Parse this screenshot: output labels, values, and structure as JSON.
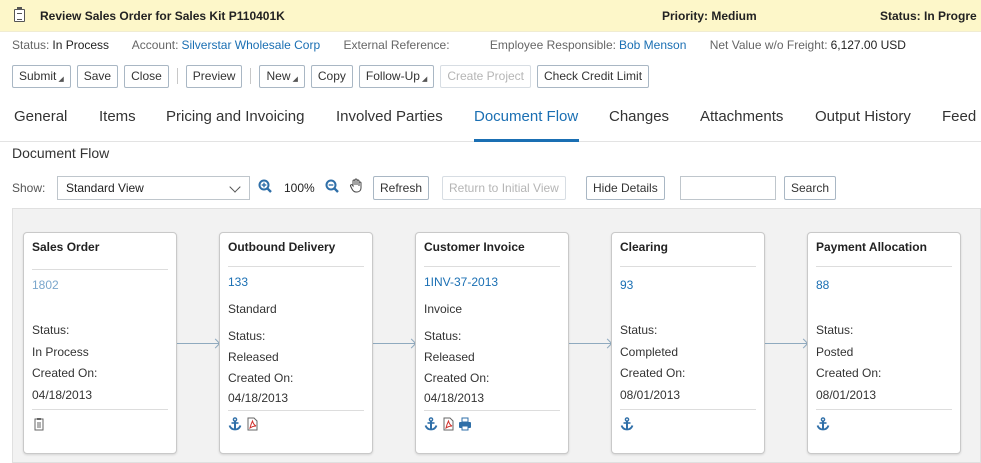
{
  "header": {
    "title": "Review Sales Order for Sales Kit P110401K",
    "priority": "Priority: Medium",
    "status": "Status: In Progre"
  },
  "info": {
    "status_label": "Status:",
    "status_value": "In Process",
    "account_label": "Account:",
    "account_value": "Silverstar Wholesale Corp",
    "extref_label": "External Reference:",
    "employee_label": "Employee Responsible:",
    "employee_value": "Bob Menson",
    "netvalue_label": "Net Value w/o Freight:",
    "netvalue_value": "6,127.00 USD"
  },
  "toolbar": {
    "submit": "Submit",
    "save": "Save",
    "close": "Close",
    "preview": "Preview",
    "new": "New",
    "copy": "Copy",
    "followup": "Follow-Up",
    "create_project": "Create Project",
    "check_credit": "Check Credit Limit"
  },
  "tabs": [
    "General",
    "Items",
    "Pricing and Invoicing",
    "Involved Parties",
    "Document Flow",
    "Changes",
    "Attachments",
    "Output History",
    "Feed"
  ],
  "active_tab": "Document Flow",
  "section_title": "Document Flow",
  "flow_toolbar": {
    "show_label": "Show:",
    "view_value": "Standard View",
    "zoom": "100%",
    "refresh": "Refresh",
    "return": "Return to Initial View",
    "hide_details": "Hide Details",
    "search_value": "",
    "search": "Search"
  },
  "cards": [
    {
      "title": "Sales Order",
      "id": "1802",
      "type": "",
      "status_label": "Status:",
      "status": "In Process",
      "created_label": "Created On:",
      "created": "04/18/2013",
      "icons": [
        "document-icon"
      ]
    },
    {
      "title": "Outbound Delivery",
      "id": "133",
      "type": "Standard",
      "status_label": "Status:",
      "status": "Released",
      "created_label": "Created On:",
      "created": "04/18/2013",
      "icons": [
        "anchor-icon",
        "pdf-icon"
      ]
    },
    {
      "title": "Customer Invoice",
      "id": "1INV-37-2013",
      "type": "Invoice",
      "status_label": "Status:",
      "status": "Released",
      "created_label": "Created On:",
      "created": "04/18/2013",
      "icons": [
        "anchor-icon",
        "pdf-icon",
        "print-icon"
      ]
    },
    {
      "title": "Clearing",
      "id": "93",
      "type": "",
      "status_label": "Status:",
      "status": "Completed",
      "created_label": "Created On:",
      "created": "08/01/2013",
      "icons": [
        "anchor-icon"
      ]
    },
    {
      "title": "Payment Allocation",
      "id": "88",
      "type": "",
      "status_label": "Status:",
      "status": "Posted",
      "created_label": "Created On:",
      "created": "08/01/2013",
      "icons": [
        "anchor-icon"
      ]
    }
  ],
  "colors": {
    "accent": "#1a6fb3",
    "title_bar": "#fdf7c9",
    "canvas": "#f2f2f2"
  }
}
